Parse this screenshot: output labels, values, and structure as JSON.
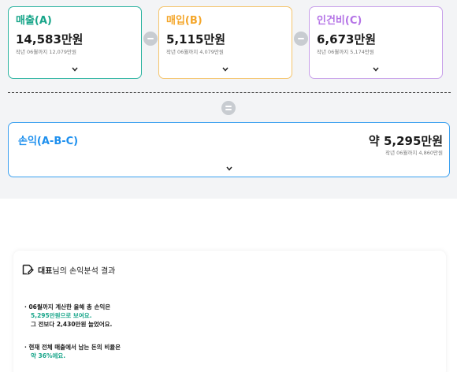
{
  "cards": {
    "sales": {
      "title": "매출(A)",
      "amount": "14,583만원",
      "sub": "작년 06월까지 12,079만원"
    },
    "purchase": {
      "title": "매입(B)",
      "amount": "5,115만원",
      "sub": "작년 06월까지 4,079만원"
    },
    "labor": {
      "title": "인건비(C)",
      "amount": "6,673만원",
      "sub": "작년 06월까지 5,174만원"
    }
  },
  "profit": {
    "title": "손익(A-B-C)",
    "amount": "약 5,295만원",
    "sub": "작년 06월까지 4,860만원"
  },
  "result": {
    "title_bold": "대표",
    "title_rest": "님의 손익분석 결과",
    "bullet1": {
      "line1": "· 06월까지 계산한 올해 총 손익은",
      "line2": "5,295만원으로 보여요.",
      "line3": "그 전보다 2,430만원 늘었어요."
    },
    "bullet2": {
      "line1": "· 현재 전체 매출에서 남는 돈의 비율은",
      "line2": "약 36%에요."
    }
  },
  "colors": {
    "sales": "#17a589",
    "purchase": "#f4a62a",
    "labor": "#b473e6",
    "profit": "#1e90ee"
  },
  "icons": {
    "expand": "chevron-down-icon",
    "minus": "minus-circle-icon",
    "equals": "equals-circle-icon",
    "result": "edit-note-icon"
  }
}
